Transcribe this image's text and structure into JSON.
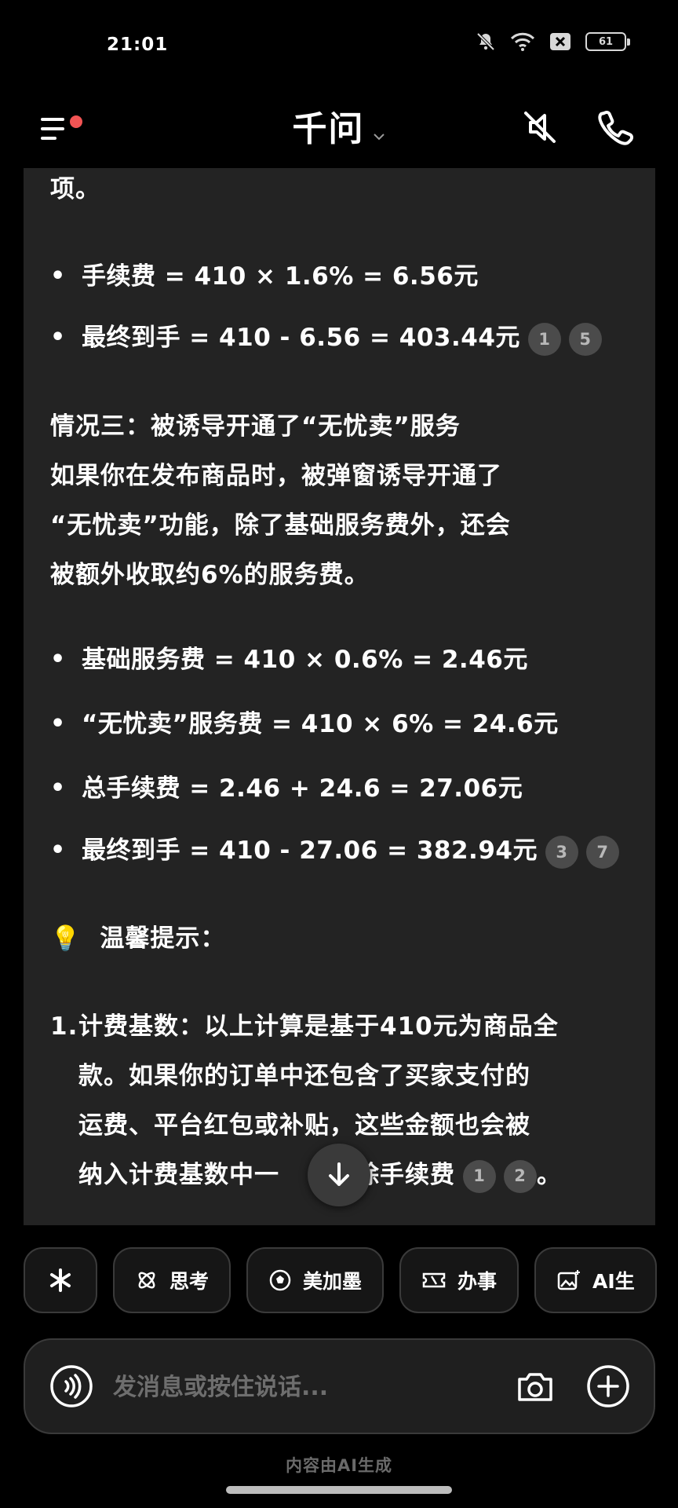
{
  "status_bar": {
    "time": "21:01",
    "battery": "61"
  },
  "header": {
    "title": "千问"
  },
  "chat": {
    "frag_top": "项。",
    "case2_bullets": [
      {
        "text": "手续费 = 410 × 1.6% = 6.56元",
        "cites": []
      },
      {
        "text": "最终到手 = 410 - 6.56 = 403.44元",
        "cites": [
          "1",
          "5"
        ]
      }
    ],
    "case3_heading": "情况三：被诱导开通了“无忧卖”服务",
    "case3_para": [
      "如果你在发布商品时，被弹窗诱导开通了",
      "“无忧卖”功能，除了基础服务费外，还会",
      "被额外收取约6%的服务费。"
    ],
    "case3_bullets": [
      {
        "text": "基础服务费 = 410 × 0.6% = 2.46元",
        "cites": []
      },
      {
        "text": "“无忧卖”服务费 = 410 × 6% = 24.6元",
        "cites": []
      },
      {
        "text": "总手续费 = 2.46 + 24.6 = 27.06元",
        "cites": []
      },
      {
        "text": "最终到手 = 410 - 27.06 = 382.94元",
        "cites": [
          "3",
          "7"
        ]
      }
    ],
    "tip_emoji": "💡",
    "tip_title": "温馨提示：",
    "tips": [
      {
        "num": "1.",
        "lines": [
          "计费基数：以上计算是基于410元为商品全",
          "款。如果你的订单中还包含了买家支付的",
          "运费、平台红包或补贴，这些金额也会被",
          "纳入计费基数中一"
        ],
        "last_line_tail": "除手续费",
        "cites": [
          "1",
          "2"
        ],
        "end": "。"
      }
    ]
  },
  "chips": [
    {
      "label": "",
      "icon": "sparkle-icon"
    },
    {
      "label": "思考",
      "icon": "atom-icon"
    },
    {
      "label": "美加墨",
      "icon": "soccer-icon"
    },
    {
      "label": "办事",
      "icon": "ticket-icon"
    },
    {
      "label": "AI生",
      "icon": "image-ai-icon"
    }
  ],
  "input": {
    "placeholder": "发消息或按住说话..."
  },
  "footer": {
    "note": "内容由AI生成"
  },
  "colors": {
    "background": "#000000",
    "card": "#232323",
    "accent_dot": "#f25454",
    "cite_bg": "#4b4b4b"
  }
}
